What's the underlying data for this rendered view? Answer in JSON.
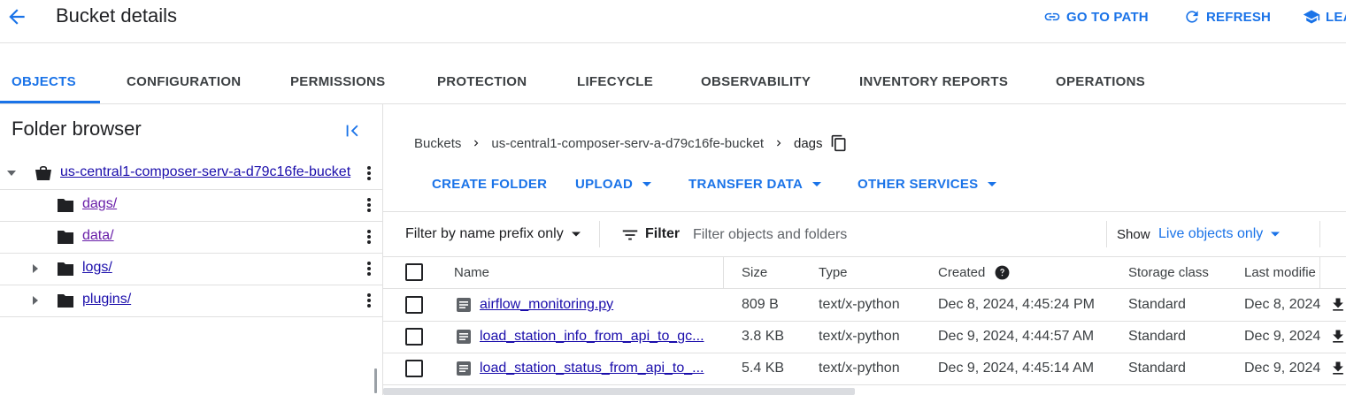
{
  "header": {
    "title": "Bucket details",
    "actions": [
      {
        "label": "GO TO PATH",
        "icon": "link-icon"
      },
      {
        "label": "REFRESH",
        "icon": "refresh-icon"
      },
      {
        "label": "LEA",
        "icon": "school-icon"
      }
    ]
  },
  "tabs": [
    {
      "label": "OBJECTS",
      "active": true
    },
    {
      "label": "CONFIGURATION"
    },
    {
      "label": "PERMISSIONS"
    },
    {
      "label": "PROTECTION"
    },
    {
      "label": "LIFECYCLE"
    },
    {
      "label": "OBSERVABILITY"
    },
    {
      "label": "INVENTORY REPORTS"
    },
    {
      "label": "OPERATIONS"
    }
  ],
  "folder_browser": {
    "title": "Folder browser",
    "bucket": "us-central1-composer-serv-a-d79c16fe-bucket",
    "folders": [
      {
        "label": "dags/",
        "expandable": false
      },
      {
        "label": "data/",
        "expandable": false
      },
      {
        "label": "logs/",
        "expandable": true
      },
      {
        "label": "plugins/",
        "expandable": true
      }
    ]
  },
  "breadcrumb": {
    "root": "Buckets",
    "bucket": "us-central1-composer-serv-a-d79c16fe-bucket",
    "current": "dags"
  },
  "actions": [
    {
      "label": "CREATE FOLDER",
      "dropdown": false
    },
    {
      "label": "UPLOAD",
      "dropdown": true
    },
    {
      "label": "TRANSFER DATA",
      "dropdown": true
    },
    {
      "label": "OTHER SERVICES",
      "dropdown": true
    }
  ],
  "filter": {
    "prefix_mode": "Filter by name prefix only",
    "label": "Filter",
    "placeholder": "Filter objects and folders",
    "show_label": "Show",
    "show_value": "Live objects only"
  },
  "table": {
    "columns": [
      "Name",
      "Size",
      "Type",
      "Created",
      "Storage class",
      "Last modifie"
    ],
    "rows": [
      {
        "name": "airflow_monitoring.py",
        "size": "809 B",
        "type": "text/x-python",
        "created": "Dec 8, 2024, 4:45:24 PM",
        "storage_class": "Standard",
        "last_modified": "Dec 8, 2024"
      },
      {
        "name": "load_station_info_from_api_to_gc...",
        "size": "3.8 KB",
        "type": "text/x-python",
        "created": "Dec 9, 2024, 4:44:57 AM",
        "storage_class": "Standard",
        "last_modified": "Dec 9, 2024"
      },
      {
        "name": "load_station_status_from_api_to_...",
        "size": "5.4 KB",
        "type": "text/x-python",
        "created": "Dec 9, 2024, 4:45:14 AM",
        "storage_class": "Standard",
        "last_modified": "Dec 9, 2024"
      }
    ]
  },
  "colors": {
    "accent": "#1a73e8",
    "link": "#1a0dab",
    "visited_link": "#681da8",
    "text": "#202124",
    "border": "#e0e0e0"
  }
}
